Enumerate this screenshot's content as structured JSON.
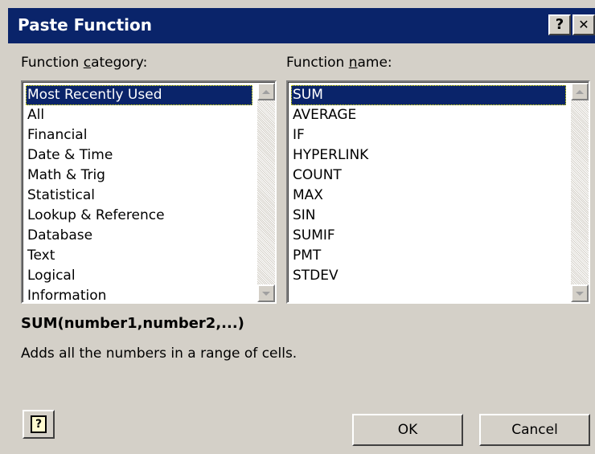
{
  "window": {
    "title": "Paste Function",
    "help_glyph": "?",
    "close_glyph": "✕"
  },
  "category": {
    "label_pre": "Function ",
    "label_accel": "c",
    "label_post": "ategory:",
    "items": [
      "Most Recently Used",
      "All",
      "Financial",
      "Date & Time",
      "Math & Trig",
      "Statistical",
      "Lookup & Reference",
      "Database",
      "Text",
      "Logical",
      "Information"
    ],
    "selected": "Most Recently Used"
  },
  "function_name": {
    "label_pre": "Function ",
    "label_accel": "n",
    "label_post": "ame:",
    "items": [
      "SUM",
      "AVERAGE",
      "IF",
      "HYPERLINK",
      "COUNT",
      "MAX",
      "SIN",
      "SUMIF",
      "PMT",
      "STDEV"
    ],
    "selected": "SUM"
  },
  "syntax": "SUM(number1,number2,...)",
  "description": "Adds all the numbers in a range of cells.",
  "buttons": {
    "ok": "OK",
    "cancel": "Cancel",
    "assistant_glyph": "?"
  },
  "colors": {
    "titlebar": "#0a246a",
    "face": "#d4d0c8",
    "selection": "#0a246a"
  },
  "icons": {
    "help": "help-icon",
    "close": "close-icon",
    "assistant": "office-assistant-icon",
    "scroll_up": "scroll-up-arrow-icon",
    "scroll_down": "scroll-down-arrow-icon"
  }
}
